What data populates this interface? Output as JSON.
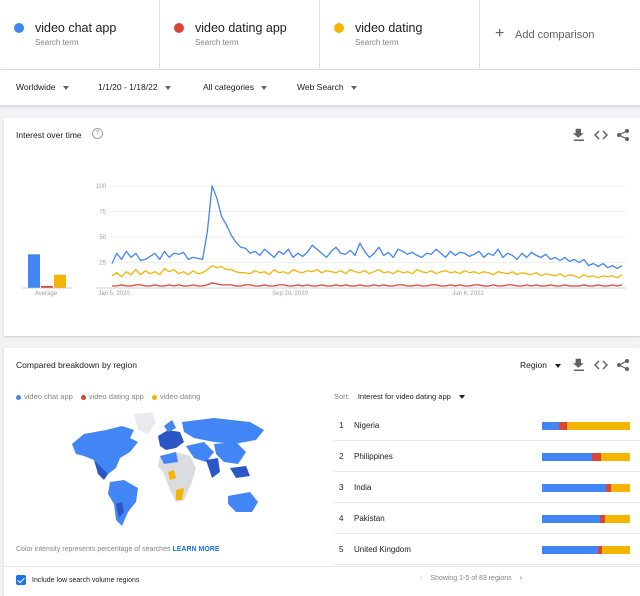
{
  "terms": [
    {
      "name": "video chat app",
      "sub": "Search term",
      "color": "#4285f4"
    },
    {
      "name": "video dating app",
      "sub": "Search term",
      "color": "#db4437"
    },
    {
      "name": "video dating",
      "sub": "Search term",
      "color": "#f4b400"
    }
  ],
  "add_comparison": "Add comparison",
  "filters": {
    "location": "Worldwide",
    "date_range": "1/1/20 - 1/18/22",
    "category": "All categories",
    "property": "Web Search"
  },
  "interest": {
    "title": "Interest over time",
    "average_label": "Average"
  },
  "chart_data": {
    "type": "line",
    "title": "Interest over time",
    "x_tick_labels": [
      "Jan 5, 2020",
      "Sep 20, 2020",
      "Jun 6, 2021"
    ],
    "ylim": [
      0,
      100
    ],
    "y_ticks": [
      25,
      50,
      75,
      100
    ],
    "grid": true,
    "averages": [
      {
        "name": "video chat app",
        "value": 33
      },
      {
        "name": "video dating app",
        "value": 2
      },
      {
        "name": "video dating",
        "value": 13
      }
    ],
    "series": [
      {
        "name": "video chat app",
        "color": "#4285f4",
        "values": [
          24,
          34,
          28,
          36,
          30,
          34,
          27,
          28,
          31,
          34,
          28,
          36,
          30,
          34,
          33,
          35,
          28,
          30,
          29,
          28,
          55,
          100,
          88,
          70,
          62,
          52,
          45,
          40,
          39,
          34,
          36,
          32,
          38,
          34,
          30,
          36,
          33,
          38,
          30,
          34,
          31,
          35,
          42,
          38,
          34,
          30,
          36,
          40,
          34,
          33,
          37,
          32,
          44,
          36,
          30,
          34,
          40,
          32,
          35,
          30,
          38,
          36,
          33,
          35,
          32,
          30,
          34,
          33,
          38,
          34,
          30,
          36,
          32,
          35,
          34,
          31,
          33,
          36,
          30,
          34,
          32,
          38,
          30,
          34,
          32,
          28,
          34,
          30,
          35,
          32,
          30,
          33,
          28,
          30,
          27,
          30,
          26,
          28,
          25,
          28,
          22,
          24,
          21,
          24,
          20,
          22,
          19,
          22
        ]
      },
      {
        "name": "video dating app",
        "color": "#db4437",
        "values": [
          2,
          2,
          3,
          2,
          2,
          3,
          3,
          2,
          2,
          3,
          2,
          2,
          3,
          2,
          3,
          2,
          2,
          3,
          2,
          2,
          3,
          5,
          4,
          3,
          3,
          3,
          2,
          2,
          3,
          3,
          2,
          2,
          3,
          2,
          2,
          3,
          3,
          2,
          2,
          3,
          2,
          3,
          2,
          2,
          3,
          2,
          2,
          3,
          2,
          3,
          2,
          2,
          3,
          2,
          2,
          3,
          2,
          3,
          2,
          2,
          3,
          3,
          2,
          2,
          3,
          2,
          2,
          3,
          3,
          2,
          2,
          3,
          2,
          3,
          2,
          2,
          3,
          3,
          2,
          2,
          3,
          2,
          2,
          3,
          3,
          2,
          2,
          3,
          2,
          3,
          2,
          2,
          3,
          2,
          2,
          3,
          2,
          2,
          2,
          3,
          2,
          2,
          3,
          2,
          2,
          3,
          2,
          3
        ]
      },
      {
        "name": "video dating",
        "color": "#f4b400",
        "values": [
          12,
          15,
          11,
          16,
          13,
          18,
          13,
          17,
          14,
          16,
          13,
          19,
          16,
          18,
          14,
          16,
          13,
          17,
          14,
          15,
          18,
          22,
          20,
          21,
          18,
          18,
          16,
          15,
          15,
          14,
          17,
          15,
          16,
          13,
          18,
          15,
          16,
          14,
          18,
          16,
          15,
          17,
          16,
          18,
          15,
          17,
          16,
          15,
          17,
          14,
          18,
          16,
          15,
          17,
          14,
          16,
          18,
          15,
          16,
          14,
          17,
          15,
          16,
          14,
          18,
          16,
          15,
          17,
          14,
          16,
          17,
          15,
          16,
          14,
          17,
          15,
          16,
          14,
          16,
          15,
          13,
          16,
          15,
          14,
          16,
          13,
          15,
          14,
          13,
          15,
          12,
          14,
          13,
          12,
          14,
          11,
          13,
          12,
          10,
          13,
          11,
          12,
          10,
          12,
          11,
          12,
          10,
          13
        ]
      }
    ]
  },
  "region": {
    "title": "Compared breakdown by region",
    "region_select": "Region",
    "map_note": "Color intensity represents percentage of searches",
    "learn_more": "LEARN MORE",
    "sort_label": "Sort:",
    "sort_value": "Interest for video dating app",
    "include_low": "Include low search volume regions",
    "pager_text": "Showing 1-5 of 83 regions",
    "rows": [
      {
        "rank": "1",
        "name": "Nigeria",
        "shares": [
          0.19,
          0.09,
          0.72
        ]
      },
      {
        "rank": "2",
        "name": "Philippines",
        "shares": [
          0.57,
          0.1,
          0.33
        ]
      },
      {
        "rank": "3",
        "name": "India",
        "shares": [
          0.73,
          0.05,
          0.22
        ]
      },
      {
        "rank": "4",
        "name": "Pakistan",
        "shares": [
          0.66,
          0.06,
          0.28
        ]
      },
      {
        "rank": "5",
        "name": "United Kingdom",
        "shares": [
          0.64,
          0.04,
          0.32
        ]
      }
    ]
  }
}
